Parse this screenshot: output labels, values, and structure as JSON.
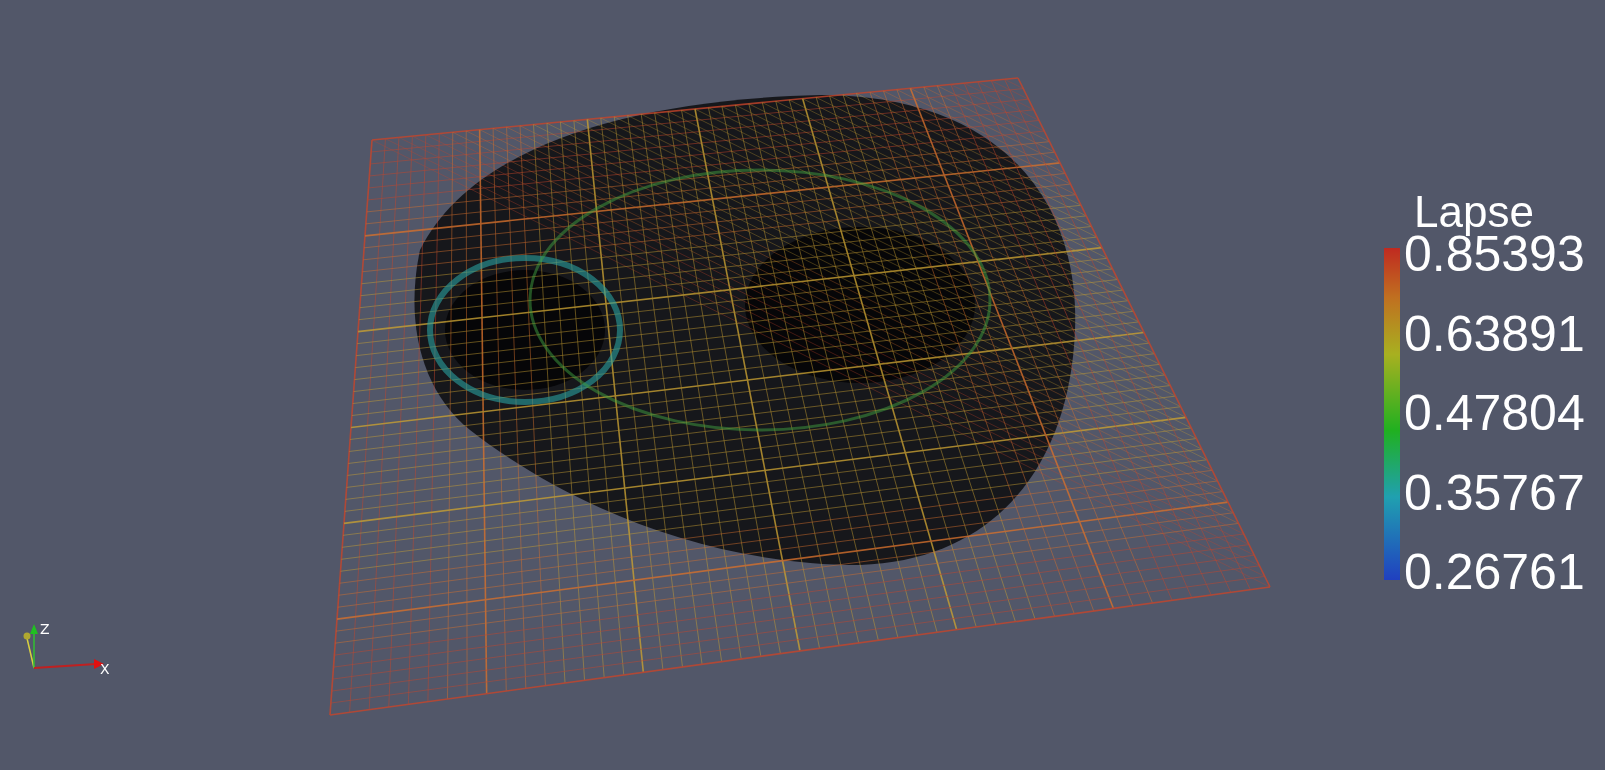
{
  "color_legend": {
    "title": "Lapse",
    "labels": [
      "0.85393",
      "0.63891",
      "0.47804",
      "0.35767",
      "0.26761"
    ]
  },
  "axes": {
    "labels": [
      "Z",
      "X"
    ]
  }
}
